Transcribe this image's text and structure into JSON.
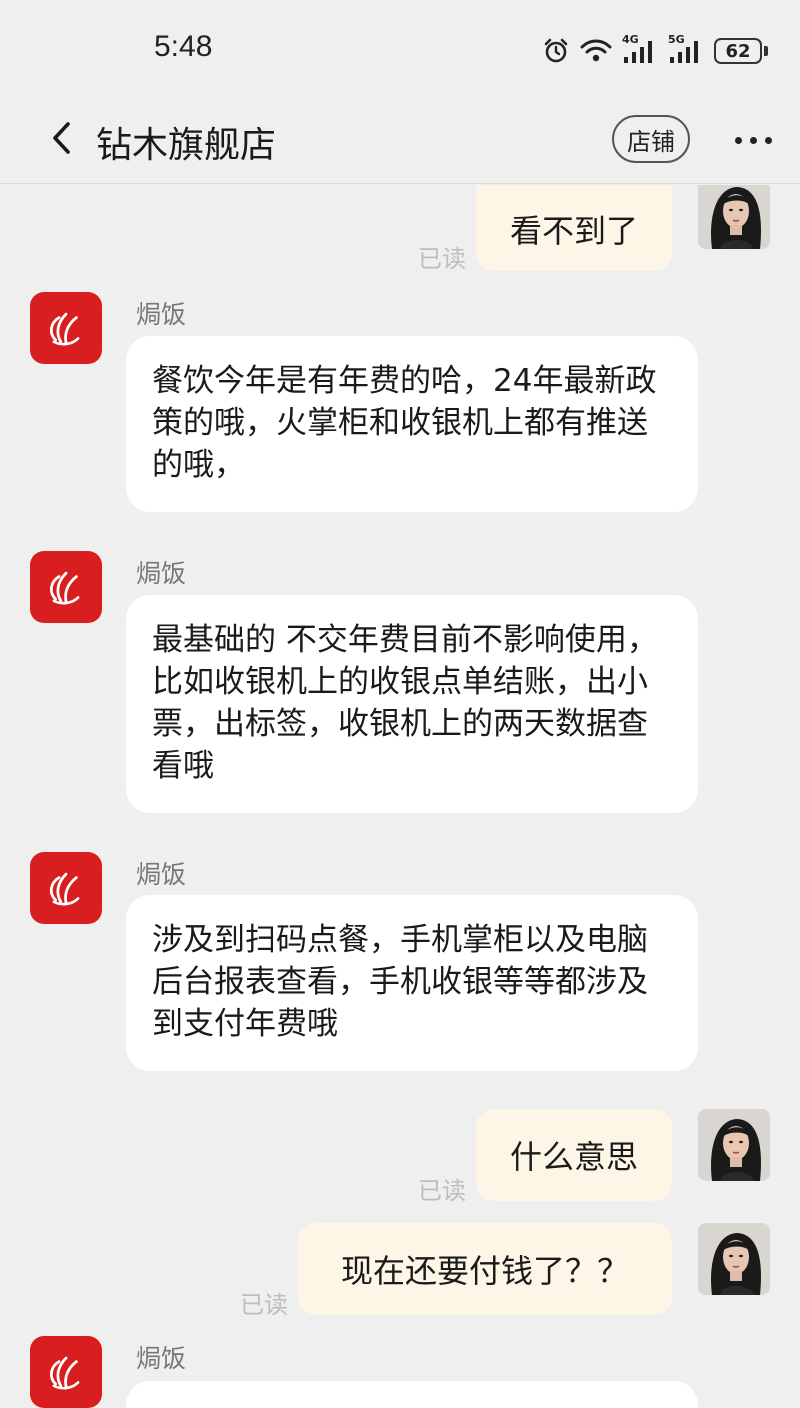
{
  "status_bar": {
    "time": "5:48",
    "network_1": "4G",
    "network_2": "5G",
    "battery": "62",
    "icons": [
      "alarm-icon",
      "wifi-icon",
      "signal-4g-icon",
      "signal-5g-icon",
      "battery-icon"
    ]
  },
  "nav": {
    "back_icon": "chevron-left-icon",
    "title": "钻木旗舰店",
    "shop_button": "店铺",
    "more_icon": "more-dots-icon"
  },
  "messages": [
    {
      "direction": "out",
      "text": "看不到了",
      "status": "已读"
    },
    {
      "direction": "in",
      "sender": "焗饭",
      "text": "餐饮今年是有年费的哈，24年最新政策的哦，火掌柜和收银机上都有推送的哦，"
    },
    {
      "direction": "in",
      "sender": "焗饭",
      "text": "最基础的 不交年费目前不影响使用，比如收银机上的收银点单结账，出小票，出标签，收银机上的两天数据查看哦"
    },
    {
      "direction": "in",
      "sender": "焗饭",
      "text": "涉及到扫码点餐，手机掌柜以及电脑后台报表查看，手机收银等等都涉及到支付年费哦"
    },
    {
      "direction": "out",
      "text": "什么意思",
      "status": "已读"
    },
    {
      "direction": "out",
      "text": "现在还要付钱了？？",
      "status": "已读"
    },
    {
      "direction": "in",
      "sender": "焗饭",
      "text": ""
    }
  ],
  "colors": {
    "background": "#efefef",
    "outgoing_bubble": "#fdf6e7",
    "incoming_bubble": "#ffffff",
    "shop_avatar": "#d81e1e",
    "read_text": "#bdbdbd"
  }
}
